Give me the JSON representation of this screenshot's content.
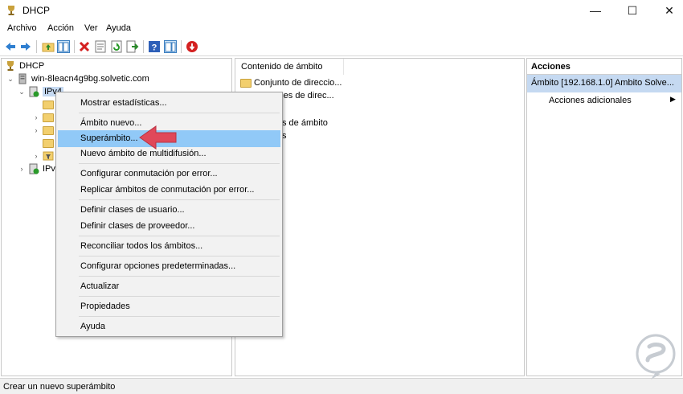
{
  "window": {
    "title": "DHCP",
    "controls": {
      "minimize": "—",
      "maximize": "☐",
      "close": "✕"
    }
  },
  "menubar": [
    "Archivo",
    "Acción",
    "Ver",
    "Ayuda"
  ],
  "tree": {
    "root": "DHCP",
    "server": "win-8leacn4g9bg.solvetic.com",
    "ipv4": "IPv4",
    "ipv6": "IPv"
  },
  "center": {
    "column_header": "Contenido de ámbito",
    "items": [
      "Conjunto de direccio...",
      "iones de direc...",
      "",
      "s de ámbito",
      "s"
    ]
  },
  "actions": {
    "title": "Acciones",
    "scope": "Ámbito [192.168.1.0] Ambito Solve...",
    "more": "Acciones adicionales",
    "more_arrow": "▶"
  },
  "context_menu": {
    "items": [
      "Mostrar estadísticas...",
      "Ámbito nuevo...",
      "Superámbito...",
      "Nuevo ámbito de multidifusión...",
      "Configurar conmutación por error...",
      "Replicar ámbitos de conmutación por error...",
      "Definir clases de usuario...",
      "Definir clases de proveedor...",
      "Reconciliar todos los ámbitos...",
      "Configurar opciones predeterminadas...",
      "Actualizar",
      "Propiedades",
      "Ayuda"
    ],
    "highlighted": "Superámbito..."
  },
  "statusbar": "Crear un nuevo superámbito",
  "colors": {
    "highlight": "#91c9f7",
    "scope_selected": "#c5d9f1",
    "annotation_arrow": "#e0485a",
    "watermark": "#c7ccd2"
  },
  "icons": [
    "dhcp-icon",
    "back-icon",
    "forward-icon",
    "up-folder-icon",
    "show-tree-icon",
    "delete-icon",
    "properties-icon",
    "refresh-icon",
    "export-icon",
    "help-icon",
    "action-pane-icon",
    "stop-icon"
  ]
}
